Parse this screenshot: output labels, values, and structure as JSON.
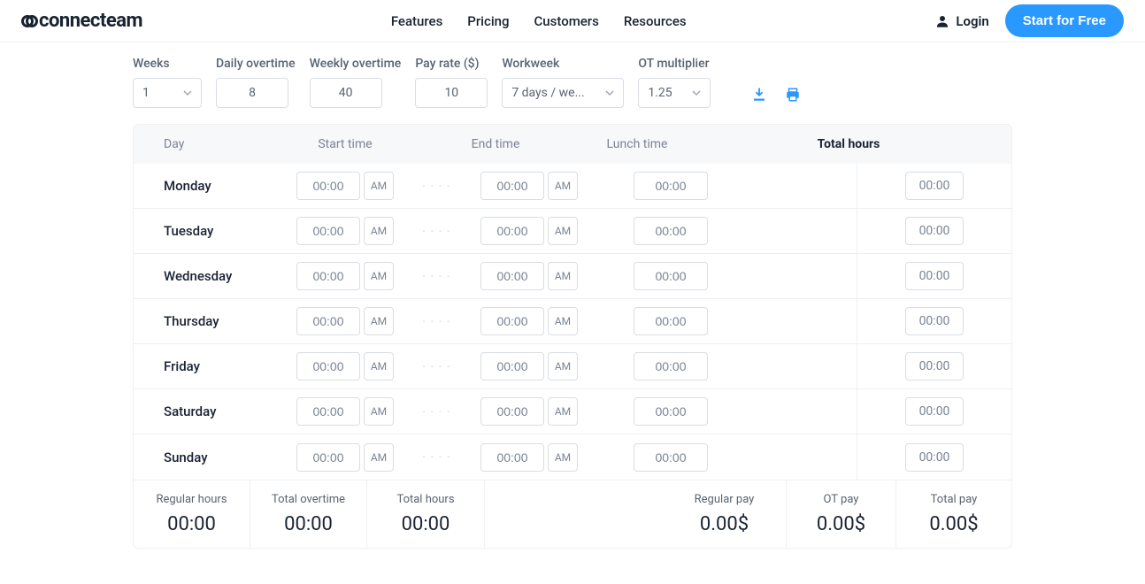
{
  "header": {
    "brand": "connecteam",
    "nav": [
      "Features",
      "Pricing",
      "Customers",
      "Resources"
    ],
    "login": "Login",
    "cta": "Start for Free"
  },
  "controls": {
    "weeks": {
      "label": "Weeks",
      "value": "1"
    },
    "daily_ot": {
      "label": "Daily overtime",
      "value": "8"
    },
    "weekly_ot": {
      "label": "Weekly overtime",
      "value": "40"
    },
    "pay_rate": {
      "label": "Pay rate ($)",
      "value": "10"
    },
    "workweek": {
      "label": "Workweek",
      "value": "7 days / we..."
    },
    "ot_mult": {
      "label": "OT multiplier",
      "value": "1.25"
    }
  },
  "table": {
    "headers": {
      "day": "Day",
      "start": "Start time",
      "end": "End time",
      "lunch": "Lunch time",
      "total": "Total hours"
    },
    "dashes": "- - - -",
    "rows": [
      {
        "day": "Monday",
        "start": "00:00",
        "start_ampm": "AM",
        "end": "00:00",
        "end_ampm": "AM",
        "lunch": "00:00",
        "total": "00:00"
      },
      {
        "day": "Tuesday",
        "start": "00:00",
        "start_ampm": "AM",
        "end": "00:00",
        "end_ampm": "AM",
        "lunch": "00:00",
        "total": "00:00"
      },
      {
        "day": "Wednesday",
        "start": "00:00",
        "start_ampm": "AM",
        "end": "00:00",
        "end_ampm": "AM",
        "lunch": "00:00",
        "total": "00:00"
      },
      {
        "day": "Thursday",
        "start": "00:00",
        "start_ampm": "AM",
        "end": "00:00",
        "end_ampm": "AM",
        "lunch": "00:00",
        "total": "00:00"
      },
      {
        "day": "Friday",
        "start": "00:00",
        "start_ampm": "AM",
        "end": "00:00",
        "end_ampm": "AM",
        "lunch": "00:00",
        "total": "00:00"
      },
      {
        "day": "Saturday",
        "start": "00:00",
        "start_ampm": "AM",
        "end": "00:00",
        "end_ampm": "AM",
        "lunch": "00:00",
        "total": "00:00"
      },
      {
        "day": "Sunday",
        "start": "00:00",
        "start_ampm": "AM",
        "end": "00:00",
        "end_ampm": "AM",
        "lunch": "00:00",
        "total": "00:00"
      }
    ]
  },
  "summary": {
    "regular_hours": {
      "label": "Regular hours",
      "value": "00:00"
    },
    "total_ot": {
      "label": "Total overtime",
      "value": "00:00"
    },
    "total_hours": {
      "label": "Total hours",
      "value": "00:00"
    },
    "regular_pay": {
      "label": "Regular pay",
      "value": "0.00$"
    },
    "ot_pay": {
      "label": "OT pay",
      "value": "0.00$"
    },
    "total_pay": {
      "label": "Total pay",
      "value": "0.00$"
    }
  }
}
